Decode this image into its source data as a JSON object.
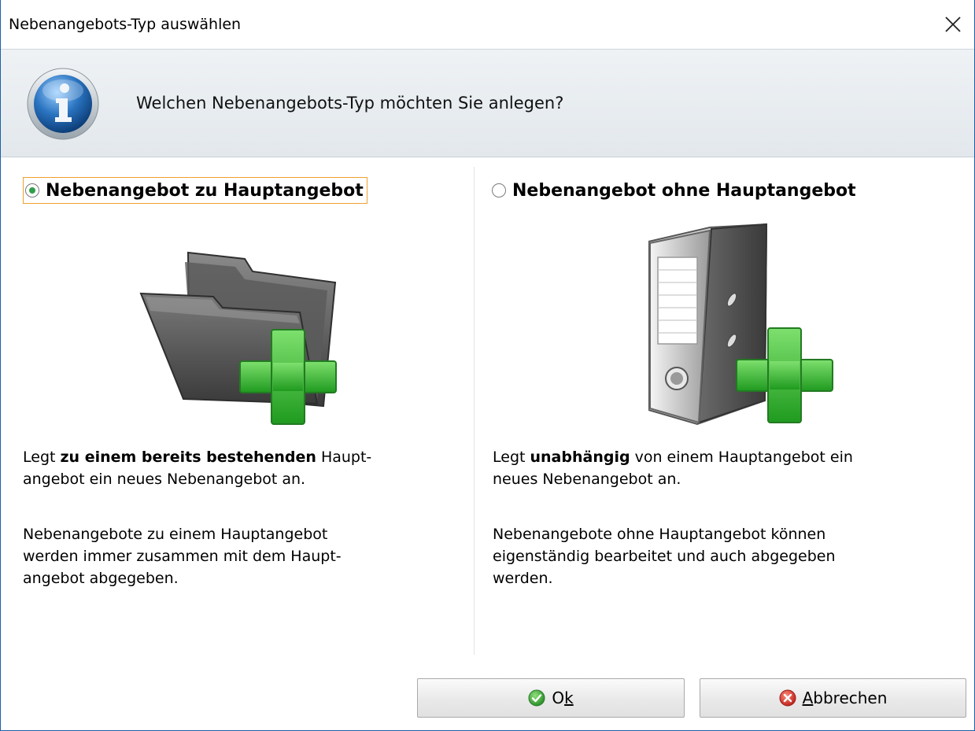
{
  "window": {
    "title": "Nebenangebots-Typ auswählen"
  },
  "header": {
    "question": "Welchen Nebenangebots-Typ möchten Sie anlegen?",
    "icon": "info-icon"
  },
  "options": [
    {
      "label": "Nebenangebot zu Hauptangebot",
      "selected": true,
      "icon": "folder-add-icon",
      "desc1_pre": "Legt ",
      "desc1_bold": "zu einem bereits bestehenden",
      "desc1_post": " Haupt-\nangebot ein neues Nebenangebot an.",
      "desc2": "Nebenangebote zu einem Hauptangebot\nwerden immer zusammen mit dem Haupt-\nangebot abgegeben."
    },
    {
      "label": "Nebenangebot ohne Hauptangebot",
      "selected": false,
      "icon": "binder-add-icon",
      "desc1_pre": "Legt ",
      "desc1_bold": "unabhängig",
      "desc1_post": " von einem Hauptangebot ein\nneues Nebenangebot an.",
      "desc2": "Nebenangebote ohne Hauptangebot können\neigenständig bearbeitet und auch abgegeben\nwerden."
    }
  ],
  "buttons": {
    "ok_pre": "O",
    "ok_accel": "k",
    "cancel_accel": "A",
    "cancel_post": "bbrechen"
  },
  "colors": {
    "accent_green": "#2f9e4a",
    "focus_orange": "#f0a030",
    "info_blue": "#2a73c0",
    "cancel_red": "#d8342c"
  }
}
